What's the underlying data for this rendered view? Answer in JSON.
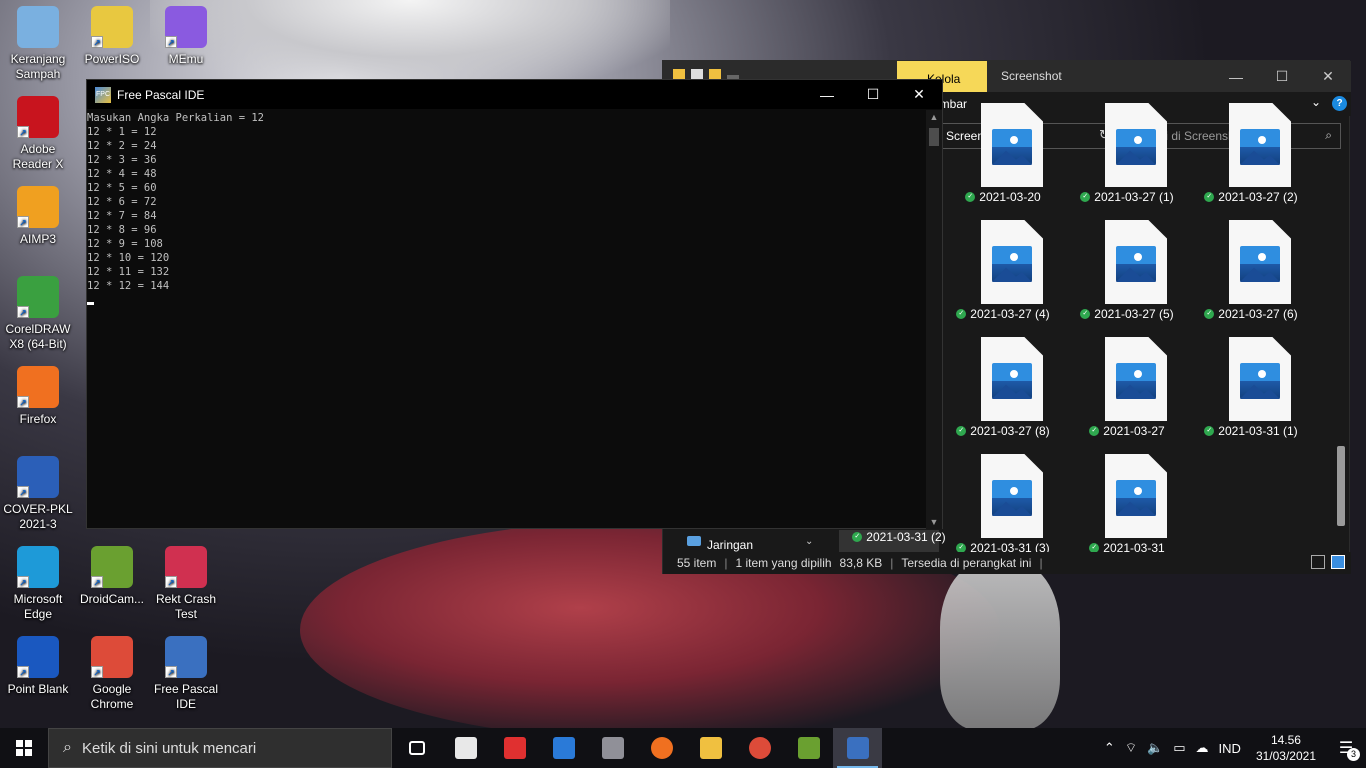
{
  "desktop_icons": [
    {
      "label": "Keranjang Sampah",
      "icon": "recycle-bin-icon",
      "color": "#7ab0e0"
    },
    {
      "label": "PowerISO",
      "icon": "poweriso-icon",
      "color": "#e8c840"
    },
    {
      "label": "MEmu",
      "icon": "memu-icon",
      "color": "#8a5ae0"
    },
    {
      "label": "Adobe Reader X",
      "icon": "adobe-reader-icon",
      "color": "#c8141e"
    },
    {
      "label": "AIMP3",
      "icon": "aimp-icon",
      "color": "#f0a020"
    },
    {
      "label": "CorelDRAW X8 (64-Bit)",
      "icon": "coreldraw-icon",
      "color": "#3aa040"
    },
    {
      "label": "Firefox",
      "icon": "firefox-icon",
      "color": "#f07020"
    },
    {
      "label": "COVER-PKL 2021-3",
      "icon": "word-doc-icon",
      "color": "#2b5fb8"
    },
    {
      "label": "Microsoft Edge",
      "icon": "edge-icon",
      "color": "#1e9ad8"
    },
    {
      "label": "DroidCam...",
      "icon": "droidcam-icon",
      "color": "#6aa030"
    },
    {
      "label": "Rekt Crash Test",
      "icon": "rekt-crash-test-icon",
      "color": "#d03050"
    },
    {
      "label": "Point Blank",
      "icon": "point-blank-icon",
      "color": "#1a58c0"
    },
    {
      "label": "Google Chrome",
      "icon": "chrome-icon",
      "color": "#dd4b39"
    },
    {
      "label": "Free Pascal IDE",
      "icon": "free-pascal-icon",
      "color": "#3a70c0"
    }
  ],
  "fp_window": {
    "title": "Free Pascal IDE",
    "console_lines": [
      "Masukan Angka Perkalian = 12",
      "12 * 1 = 12",
      "12 * 2 = 24",
      "12 * 3 = 36",
      "12 * 4 = 48",
      "12 * 5 = 60",
      "12 * 6 = 72",
      "12 * 7 = 84",
      "12 * 8 = 96",
      "12 * 9 = 108",
      "12 * 10 = 120",
      "12 * 11 = 132",
      "12 * 12 = 144"
    ]
  },
  "explorer": {
    "tab_manage": "Kelola",
    "title": "Screenshot",
    "ribbon_label": "ambar",
    "address": "Screenshot",
    "search_placeholder": "Cari di Screenshot",
    "nav_item": "Jaringan",
    "files": [
      {
        "name": "2021-03-20"
      },
      {
        "name": "2021-03-27 (1)"
      },
      {
        "name": "2021-03-27 (2)"
      },
      {
        "name": "2021-03-27 (4)"
      },
      {
        "name": "2021-03-27 (5)"
      },
      {
        "name": "2021-03-27 (6)"
      },
      {
        "name": "2021-03-27 (8)"
      },
      {
        "name": "2021-03-27"
      },
      {
        "name": "2021-03-31 (1)"
      },
      {
        "name": "2021-03-31 (3)"
      },
      {
        "name": "2021-03-31"
      },
      {
        "name": "2021-03-31 (2)"
      }
    ],
    "status": {
      "count": "55 item",
      "selected": "1 item yang dipilih",
      "size": "83,8 KB",
      "availability": "Tersedia di perangkat ini"
    }
  },
  "taskbar": {
    "search_placeholder": "Ketik di sini untuk mencari",
    "apps": [
      {
        "icon": "task-view-icon",
        "color": "#ffffff"
      },
      {
        "icon": "store-icon",
        "color": "#e8e8e8"
      },
      {
        "icon": "gift-icon",
        "color": "#e03030"
      },
      {
        "icon": "mail-icon",
        "color": "#2a7ad8"
      },
      {
        "icon": "camera-icon",
        "color": "#909098"
      },
      {
        "icon": "firefox-icon",
        "color": "#f07020"
      },
      {
        "icon": "file-explorer-icon",
        "color": "#f0c040"
      },
      {
        "icon": "chrome-icon",
        "color": "#dd4b39"
      },
      {
        "icon": "droidcam-icon",
        "color": "#6aa030"
      },
      {
        "icon": "free-pascal-icon",
        "color": "#3a70c0"
      }
    ],
    "language": "IND",
    "time": "14.56",
    "date": "31/03/2021",
    "notification_count": "3"
  }
}
